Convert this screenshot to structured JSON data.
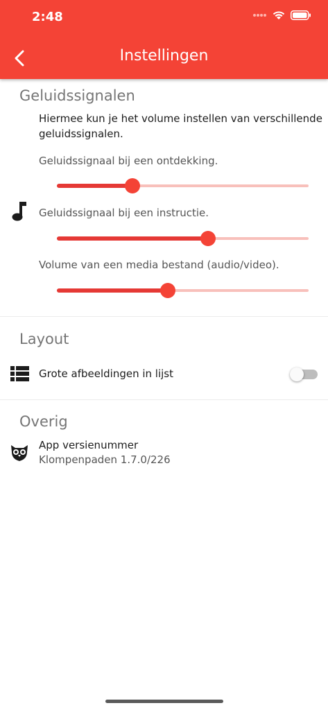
{
  "status_bar": {
    "time": "2:48"
  },
  "header": {
    "title": "Instellingen",
    "accent_color": "#f44336"
  },
  "sound": {
    "section_title": "Geluidssignalen",
    "description": "Hiermee kun je het volume instellen van verschillende geluidssignalen.",
    "sliders": [
      {
        "label": "Geluidssignaal bij een ontdekking.",
        "value": 0.3
      },
      {
        "label": "Geluidssignaal bij een instructie.",
        "value": 0.6
      },
      {
        "label": "Volume van een media bestand (audio/video).",
        "value": 0.44
      }
    ]
  },
  "layout": {
    "section_title": "Layout",
    "large_images_label": "Grote afbeeldingen in lijst",
    "large_images_enabled": false
  },
  "other": {
    "section_title": "Overig",
    "version_label": "App versienummer",
    "version_value": "Klompenpaden 1.7.0/226"
  }
}
